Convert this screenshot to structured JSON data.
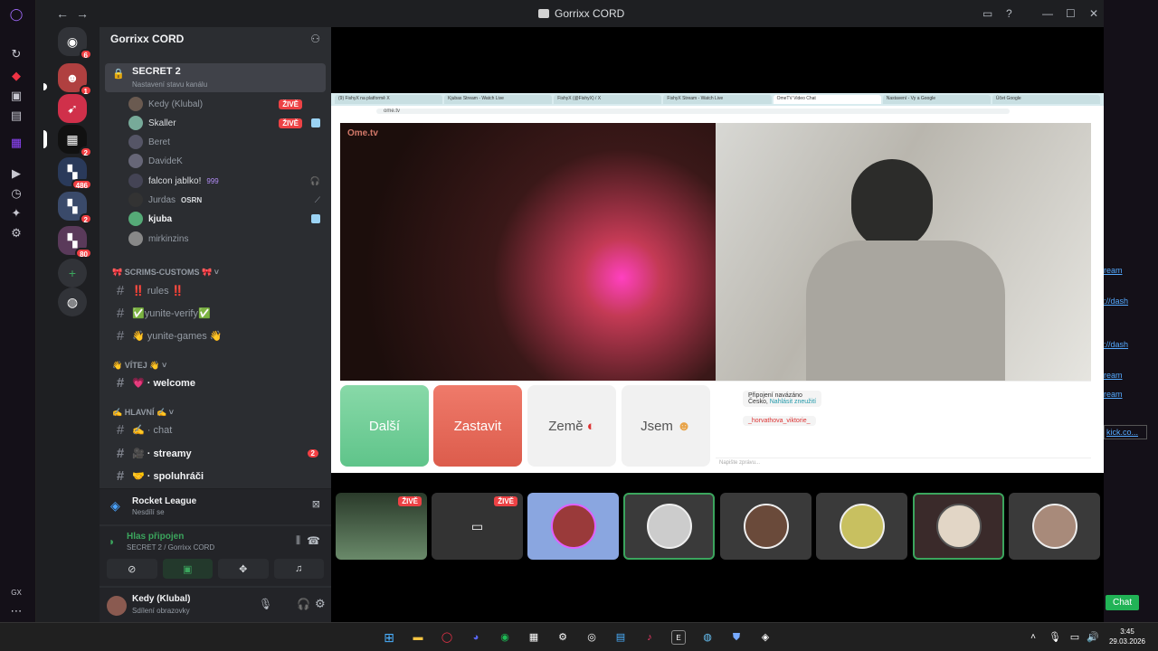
{
  "window": {
    "title": "Gorrixx CORD"
  },
  "server": {
    "name": "Gorrixx CORD"
  },
  "guild_badges": {
    "home": "6",
    "g1": "1",
    "g3": "2",
    "g4": "486",
    "g5": "2",
    "g6": "80"
  },
  "voice_channel": {
    "name": "SECRET 2",
    "status": "Nastavení stavu kanálu"
  },
  "voice_users": [
    {
      "name": "Kedy (Klubal)",
      "live": "ŽIVĚ"
    },
    {
      "name": "Skaller",
      "live": "ŽIVĚ"
    },
    {
      "name": "Beret"
    },
    {
      "name": "DavideK"
    },
    {
      "name": "falcon jablko!",
      "tag": "999"
    },
    {
      "name": "Jurdas",
      "tag": "OSRN"
    },
    {
      "name": "kjuba"
    },
    {
      "name": "mirkinzins"
    }
  ],
  "categories": {
    "scrims": "SCRIMS-CUSTOMS",
    "vitej": "VÍTEJ",
    "hlavni": "HLAVNÍ"
  },
  "channels": [
    {
      "name": "‼️ rules ‼️"
    },
    {
      "name": "✅yunite-verify✅"
    },
    {
      "name": "👋 yunite-games 👋"
    },
    {
      "name": "💗 · welcome"
    },
    {
      "name": "✍️ · chat"
    },
    {
      "name": "🎥 · streamy",
      "badge": "2"
    },
    {
      "name": "🤝 · spoluhráči"
    }
  ],
  "activity": {
    "game": "Rocket League",
    "status": "Nesdílí se"
  },
  "voice_panel": {
    "title": "Hlas připojen",
    "sub": "SECRET 2 / Gorrixx CORD"
  },
  "user": {
    "name": "Kedy (Klubal)",
    "status": "Sdílení obrazovky"
  },
  "browser": {
    "tabs": [
      "(9) FishyX na platformě X",
      "Kjubas Stream - Watch Live",
      "FishyX (@FishyX) / X",
      "FishyX Stream - Watch Live",
      "OmeTV Video Chat",
      "Nastavení - Vy a Google",
      "Účet Google"
    ],
    "url": "ome.tv",
    "logo": "Ome.tv",
    "buttons": {
      "next": "Další",
      "stop": "Zastavit",
      "country": "Země",
      "me": "Jsem"
    },
    "chat": {
      "line1": "Připojení navázáno",
      "line2": "Česko,",
      "link": "Nahlásit zneužití",
      "user": "_horvathova_viktorie_",
      "input": "Napište zprávu..."
    }
  },
  "thumbs": {
    "live1": "ŽIVĚ",
    "live2": "ŽIVĚ"
  },
  "right_panel": {
    "links": [
      "ream",
      "://dash",
      "://dash",
      "ream",
      "ream",
      "kick.co..."
    ],
    "chat_btn": "Chat"
  },
  "taskbar": {
    "time": "3:45",
    "date": "29.03.2026"
  }
}
